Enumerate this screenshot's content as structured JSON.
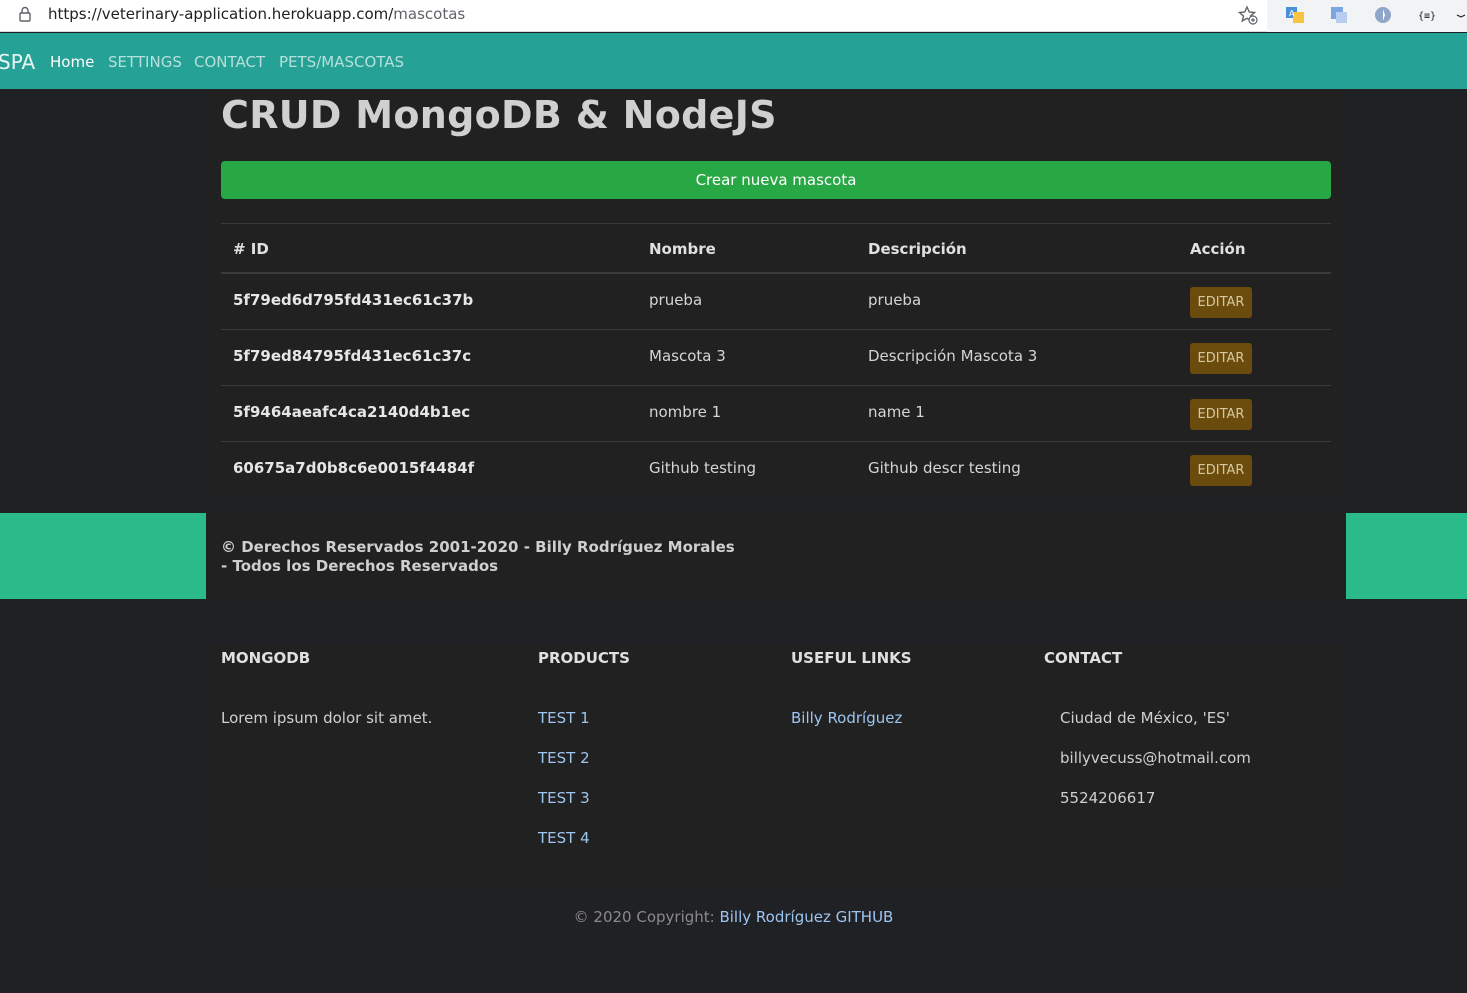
{
  "browser": {
    "url_host": "https://veterinary-application.herokuapp.com/",
    "url_path": "mascotas"
  },
  "navbar": {
    "brand": "SPA",
    "links": [
      "Home",
      "SETTINGS",
      "CONTACT",
      "PETS/MASCOTAS"
    ]
  },
  "main": {
    "title": "CRUD MongoDB & NodeJS",
    "create_button": "Crear nueva mascota",
    "table": {
      "headers": [
        "# ID",
        "Nombre",
        "Descripción",
        "Acción"
      ],
      "rows": [
        {
          "id": "5f79ed6d795fd431ec61c37b",
          "nombre": "prueba",
          "descripcion": "prueba",
          "accion": "EDITAR"
        },
        {
          "id": "5f79ed84795fd431ec61c37c",
          "nombre": "Mascota 3",
          "descripcion": "Descripción Mascota 3",
          "accion": "EDITAR"
        },
        {
          "id": "5f9464aeafc4ca2140d4b1ec",
          "nombre": "nombre 1",
          "descripcion": "name 1",
          "accion": "EDITAR"
        },
        {
          "id": "60675a7d0b8c6e0015f4484f",
          "nombre": "Github testing",
          "descripcion": "Github descr testing",
          "accion": "EDITAR"
        }
      ]
    }
  },
  "rights": {
    "line1": "© Derechos Reservados 2001-2020 - Billy Rodríguez Morales",
    "line2": "- Todos los Derechos Reservados"
  },
  "footer": {
    "mongodb": {
      "title": "MONGODB",
      "text": "Lorem ipsum dolor sit amet."
    },
    "products": {
      "title": "PRODUCTS",
      "items": [
        "TEST 1",
        "TEST 2",
        "TEST 3",
        "TEST 4"
      ]
    },
    "useful_links": {
      "title": "USEFUL LINKS",
      "items": [
        "Billy Rodríguez"
      ]
    },
    "contact": {
      "title": "CONTACT",
      "city": "Ciudad de México, 'ES'",
      "email": "billyvecuss@hotmail.com",
      "phone": "5524206617"
    }
  },
  "copyright": {
    "text": "© 2020 Copyright: ",
    "link": "Billy Rodríguez GITHUB"
  },
  "colors": {
    "navbar": "#26a196",
    "create_button": "#28a745",
    "edit_button": "#6b4c0c",
    "band": "#2bbb8a"
  }
}
